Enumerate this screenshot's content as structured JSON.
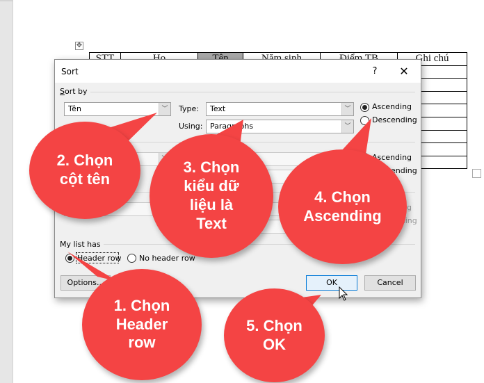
{
  "document": {
    "table": {
      "headers": [
        "STT",
        "Họ",
        "Tên",
        "Năm sinh",
        "Điểm TB",
        "Ghi chú"
      ],
      "selected_column": 2,
      "empty_rows": 8
    }
  },
  "dialog": {
    "title": "Sort",
    "help_label": "?",
    "close_label": "✕",
    "sort_by": {
      "group_label": "Sort by",
      "column_value": "Tên",
      "type_label": "Type:",
      "type_value": "Text",
      "using_label": "Using:",
      "using_value": "Paragraphs",
      "ascending_label": "Ascending",
      "descending_label": "Descending",
      "order_selected": "Ascending"
    },
    "then_by_1": {
      "ascending_label": "Ascending",
      "descending_label": "Descending"
    },
    "then_by_2": {
      "ascending_label": "Ascending",
      "descending_label": "Descending"
    },
    "my_list_has": {
      "group_label": "My list has",
      "header_row_label": "Header row",
      "no_header_row_label": "No header row",
      "selected": "Header row"
    },
    "buttons": {
      "options_label": "Options...",
      "ok_label": "OK",
      "cancel_label": "Cancel"
    }
  },
  "annotations": {
    "color": "#f44444",
    "steps": [
      {
        "text": "1. Chọn\nHeader\nrow"
      },
      {
        "text": "2. Chọn\ncột tên"
      },
      {
        "text": "3. Chọn\nkiểu dữ\nliệu là\nText"
      },
      {
        "text": "4. Chọn\nAscending"
      },
      {
        "text": "5. Chọn\nOK"
      }
    ]
  }
}
